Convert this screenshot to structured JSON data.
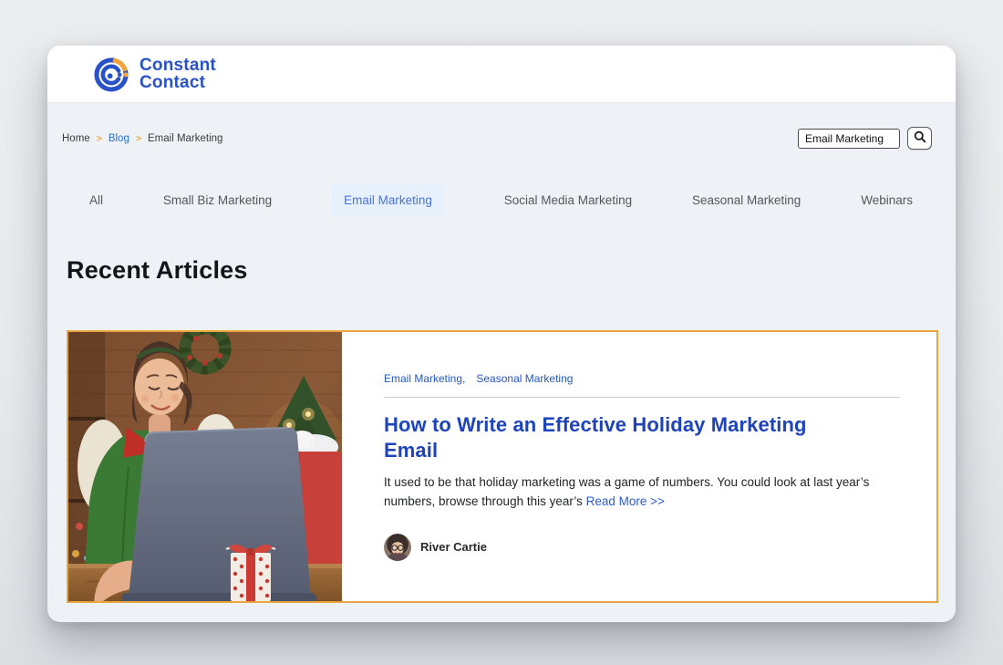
{
  "brand": {
    "line1": "Constant",
    "line2": "Contact",
    "blue": "#2a52c8",
    "orange": "#f2a33c"
  },
  "breadcrumb": {
    "separator": ">",
    "items": [
      {
        "label": "Home"
      },
      {
        "label": "Blog"
      },
      {
        "label": "Email Marketing"
      }
    ]
  },
  "search": {
    "value": "Email Marketing",
    "icon": "magnifier-icon"
  },
  "nav": {
    "items": [
      {
        "label": "All",
        "active": false
      },
      {
        "label": "Small Biz Marketing",
        "active": false
      },
      {
        "label": "Email Marketing",
        "active": true
      },
      {
        "label": "Social Media Marketing",
        "active": false
      },
      {
        "label": "Seasonal Marketing",
        "active": false
      },
      {
        "label": "Webinars",
        "active": false
      }
    ]
  },
  "main": {
    "heading": "Recent Articles"
  },
  "article": {
    "categories": [
      {
        "label": "Email Marketing,"
      },
      {
        "label": "Seasonal Marketing"
      }
    ],
    "title": "How to Write an Effective Holiday Marketing Email",
    "excerpt": "It used to be that holiday marketing was a game of numbers. You could look at last year’s numbers, browse through this year’s",
    "read_more": "Read More >>",
    "author": {
      "name": "River Cartie"
    }
  },
  "colors": {
    "outer_bg": "#e7e9ec",
    "page_bg": "#eef1f5",
    "header_bg": "#ffffff",
    "card_border": "#e9a63e",
    "title_blue": "#1d43bd",
    "link_blue": "#2d5bd4",
    "nav_text": "#54585c",
    "nav_active_text": "#4a72d8",
    "nav_active_bg": "#e7f1fc",
    "breadcrumb_sep_orange": "#f2a33c"
  }
}
